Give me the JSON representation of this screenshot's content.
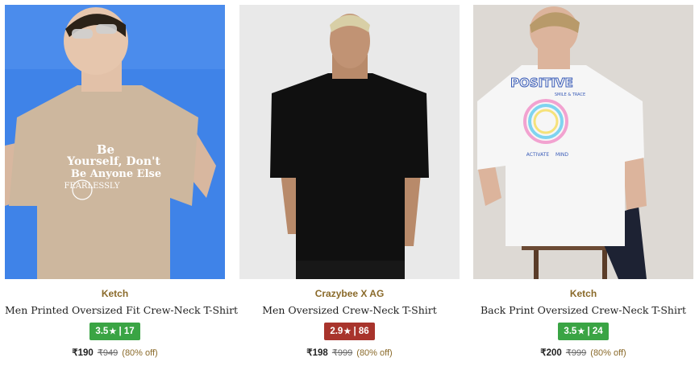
{
  "products": [
    {
      "brand": "Ketch",
      "title": "Men Printed Oversized Fit Crew-Neck T-Shirt",
      "rating": "3.5",
      "rating_count": "17",
      "rating_color": "#3aa444",
      "price": "₹190",
      "mrp": "₹949",
      "discount": "(80% off)",
      "print_text": [
        "Be",
        "Yourself, Don't",
        "Be Anyone Else",
        "FEARLESSLY"
      ]
    },
    {
      "brand": "Crazybee X AG",
      "title": "Men Oversized Crew-Neck T-Shirt",
      "rating": "2.9",
      "rating_count": "86",
      "rating_color": "#a8342c",
      "price": "₹198",
      "mrp": "₹999",
      "discount": "(80% off)"
    },
    {
      "brand": "Ketch",
      "title": "Back Print Oversized Crew-Neck T-Shirt",
      "rating": "3.5",
      "rating_count": "24",
      "rating_color": "#3aa444",
      "price": "₹200",
      "mrp": "₹999",
      "discount": "(80% off)",
      "print_text": [
        "POSITIVE",
        "SMILE & TRACE",
        "ACTIVATE",
        "MIND"
      ]
    }
  ],
  "icons": {
    "rating_star": "star-icon"
  },
  "colors": {
    "brand_text": "#8a6a2a",
    "rating_good": "#3aa444",
    "rating_poor": "#a8342c"
  }
}
